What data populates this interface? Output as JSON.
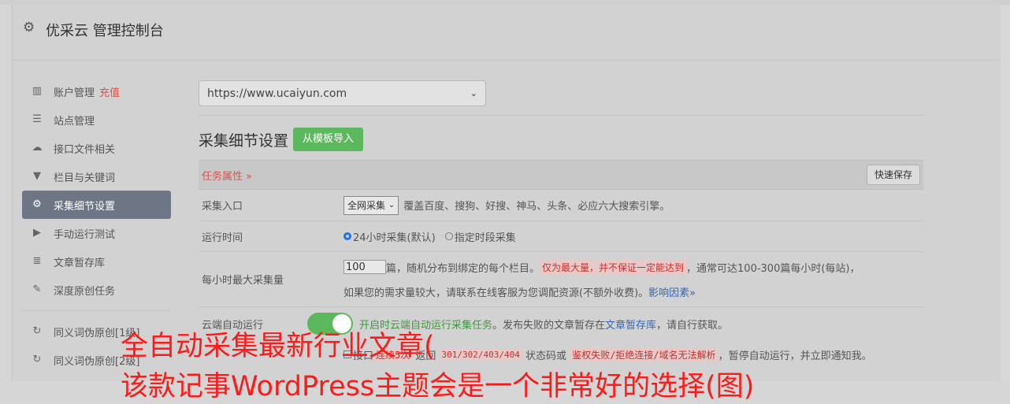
{
  "header": {
    "title": "优采云 管理控制台",
    "icon": "gear-icon"
  },
  "sidebar": {
    "items": [
      {
        "label": "账户管理",
        "extra": "充值",
        "icon": "bar-chart-icon"
      },
      {
        "label": "站点管理",
        "icon": "server-icon"
      },
      {
        "label": "接口文件相关",
        "icon": "cloud-upload-icon"
      },
      {
        "label": "栏目与关键词",
        "icon": "filter-icon"
      },
      {
        "label": "采集细节设置",
        "icon": "cogs-icon",
        "active": true
      },
      {
        "label": "手动运行测试",
        "icon": "play-circle-icon"
      },
      {
        "label": "文章暂存库",
        "icon": "database-icon"
      },
      {
        "label": "深度原创任务",
        "icon": "edit-icon"
      },
      {
        "label": "同义词伪原创[1级]",
        "icon": "refresh-icon"
      },
      {
        "label": "同义词伪原创[2级]",
        "icon": "refresh-icon"
      }
    ]
  },
  "main": {
    "site_select": "https://www.ucaiyun.com",
    "section_title": "采集细节设置",
    "import_button": "从模板导入",
    "task_attr": "任务属性 »",
    "quick_save": "快速保存",
    "rows": {
      "entry": {
        "label": "采集入口",
        "select": "全网采集",
        "desc": "覆盖百度、搜狗、好搜、神马、头条、必应六大搜索引擎。"
      },
      "runtime": {
        "label": "运行时间",
        "opt1": "24小时采集(默认)",
        "opt2": "指定时段采集"
      },
      "max": {
        "label": "每小时最大采集量",
        "value": "100",
        "t1": "篇，随机分布到绑定的每个栏目。",
        "warn": "仅为最大量，并不保证一定能达到",
        "t2": "，通常可达100-300篇每小时(每站)，",
        "t3": "如果您的需求量较大，请联系在线客服为您调配资源(不额外收费)。",
        "link": "影响因素»"
      },
      "cloud": {
        "label": "云端自动运行",
        "t1": "开启时云端自动运行采集任务",
        "t2": "。发布失败的文章暂存在",
        "link": "文章暂存库",
        "t3": "，请自行获取。"
      },
      "stop": {
        "t1": "接口",
        "pink1": "连续5次",
        "t2": "返回",
        "pink2": "301/302/403/404",
        "t3": "状态码或",
        "pink3": "鉴权失败/拒绝连接/域名无法解析",
        "t4": "，暂停自动运行，并立即通知我。"
      }
    }
  },
  "overlay": {
    "line1": "全自动采集最新行业文章(",
    "line2": "该款记事WordPress主题会是一个非常好的选择(图)"
  },
  "colors": {
    "accent_green": "#5cb85c",
    "warn_red": "#d9534f",
    "active_bg": "#6e7584",
    "overlay_red": "#ff1a1a"
  }
}
